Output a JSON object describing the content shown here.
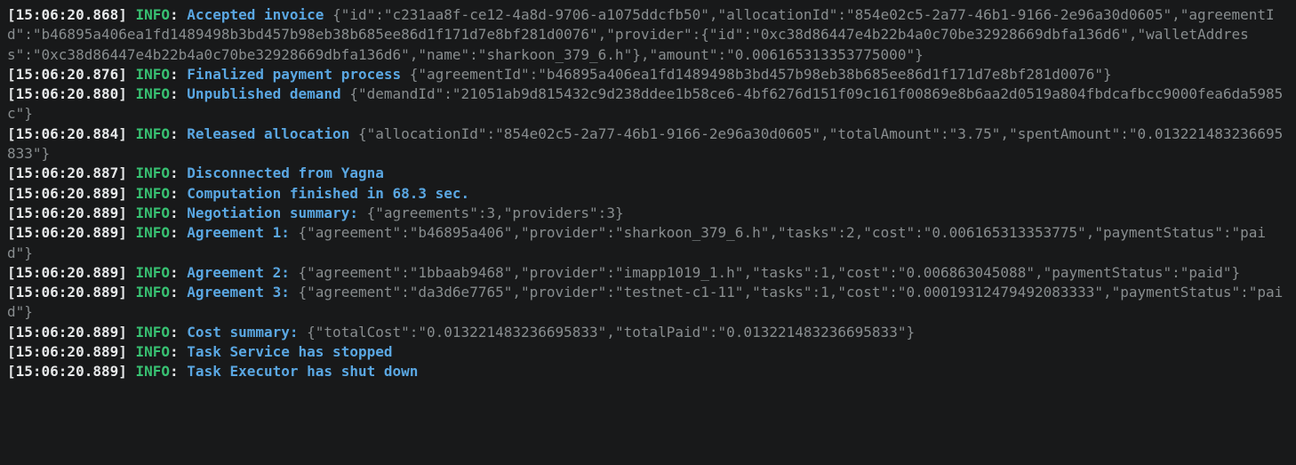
{
  "colors": {
    "background": "#18191a",
    "timestamp": "#e7e9ea",
    "level_info": "#38c172",
    "message": "#5aa7e2",
    "payload": "#888d8f"
  },
  "log": [
    {
      "timestamp": "[15:06:20.868] ",
      "level": "INFO",
      "sep1": ": ",
      "message": "Accepted invoice",
      "sep2": " ",
      "payload": "{\"id\":\"c231aa8f-ce12-4a8d-9706-a1075ddcfb50\",\"allocationId\":\"854e02c5-2a77-46b1-9166-2e96a30d0605\",\"agreementId\":\"b46895a406ea1fd1489498b3bd457b98eb38b685ee86d1f171d7e8bf281d0076\",\"provider\":{\"id\":\"0xc38d86447e4b22b4a0c70be32928669dbfa136d6\",\"walletAddress\":\"0xc38d86447e4b22b4a0c70be32928669dbfa136d6\",\"name\":\"sharkoon_379_6.h\"},\"amount\":\"0.006165313353775000\"}"
    },
    {
      "timestamp": "[15:06:20.876] ",
      "level": "INFO",
      "sep1": ": ",
      "message": "Finalized payment process",
      "sep2": " ",
      "payload": "{\"agreementId\":\"b46895a406ea1fd1489498b3bd457b98eb38b685ee86d1f171d7e8bf281d0076\"}"
    },
    {
      "timestamp": "[15:06:20.880] ",
      "level": "INFO",
      "sep1": ": ",
      "message": "Unpublished demand",
      "sep2": " ",
      "payload": "{\"demandId\":\"21051ab9d815432c9d238ddee1b58ce6-4bf6276d151f09c161f00869e8b6aa2d0519a804fbdcafbcc9000fea6da5985c\"}"
    },
    {
      "timestamp": "[15:06:20.884] ",
      "level": "INFO",
      "sep1": ": ",
      "message": "Released allocation",
      "sep2": " ",
      "payload": "{\"allocationId\":\"854e02c5-2a77-46b1-9166-2e96a30d0605\",\"totalAmount\":\"3.75\",\"spentAmount\":\"0.013221483236695833\"}"
    },
    {
      "timestamp": "[15:06:20.887] ",
      "level": "INFO",
      "sep1": ": ",
      "message": "Disconnected from Yagna",
      "sep2": "",
      "payload": ""
    },
    {
      "timestamp": "[15:06:20.889] ",
      "level": "INFO",
      "sep1": ": ",
      "message": "Computation finished in 68.3 sec.",
      "sep2": "",
      "payload": ""
    },
    {
      "timestamp": "[15:06:20.889] ",
      "level": "INFO",
      "sep1": ": ",
      "message": "Negotiation summary:",
      "sep2": " ",
      "payload": "{\"agreements\":3,\"providers\":3}"
    },
    {
      "timestamp": "[15:06:20.889] ",
      "level": "INFO",
      "sep1": ": ",
      "message": "Agreement 1: ",
      "sep2": "",
      "payload": "{\"agreement\":\"b46895a406\",\"provider\":\"sharkoon_379_6.h\",\"tasks\":2,\"cost\":\"0.006165313353775\",\"paymentStatus\":\"paid\"}"
    },
    {
      "timestamp": "[15:06:20.889] ",
      "level": "INFO",
      "sep1": ": ",
      "message": "Agreement 2: ",
      "sep2": "",
      "payload": "{\"agreement\":\"1bbaab9468\",\"provider\":\"imapp1019_1.h\",\"tasks\":1,\"cost\":\"0.006863045088\",\"paymentStatus\":\"paid\"}"
    },
    {
      "timestamp": "[15:06:20.889] ",
      "level": "INFO",
      "sep1": ": ",
      "message": "Agreement 3: ",
      "sep2": "",
      "payload": "{\"agreement\":\"da3d6e7765\",\"provider\":\"testnet-c1-11\",\"tasks\":1,\"cost\":\"0.00019312479492083333\",\"paymentStatus\":\"paid\"}"
    },
    {
      "timestamp": "[15:06:20.889] ",
      "level": "INFO",
      "sep1": ": ",
      "message": "Cost summary: ",
      "sep2": "",
      "payload": "{\"totalCost\":\"0.013221483236695833\",\"totalPaid\":\"0.013221483236695833\"}"
    },
    {
      "timestamp": "[15:06:20.889] ",
      "level": "INFO",
      "sep1": ": ",
      "message": "Task Service has stopped",
      "sep2": "",
      "payload": ""
    },
    {
      "timestamp": "[15:06:20.889] ",
      "level": "INFO",
      "sep1": ": ",
      "message": "Task Executor has shut down",
      "sep2": "",
      "payload": ""
    }
  ]
}
